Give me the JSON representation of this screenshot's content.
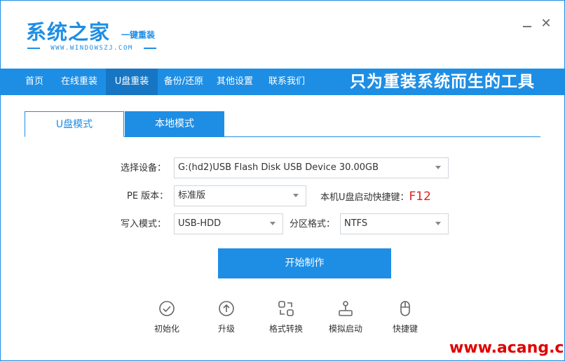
{
  "header": {
    "logo_title": "系统之家",
    "logo_subtitle": "一键重装",
    "logo_url": "WWW.WINDOWSZJ.COM",
    "minimize_label": "",
    "close_label": "✕"
  },
  "nav": {
    "items": [
      {
        "label": "首页"
      },
      {
        "label": "在线重装"
      },
      {
        "label": "U盘重装",
        "active": true
      },
      {
        "label": "备份/还原"
      },
      {
        "label": "其他设置"
      },
      {
        "label": "联系我们"
      }
    ],
    "slogan": "只为重装系统而生的工具"
  },
  "tabs": [
    {
      "label": "U盘模式",
      "active": true
    },
    {
      "label": "本地模式"
    }
  ],
  "form": {
    "device_label": "选择设备：",
    "device_value": "G:(hd2)USB Flash Disk USB Device 30.00GB",
    "pe_label": "PE 版本：",
    "pe_value": "标准版",
    "hotkey_label": "本机U盘启动快捷键：",
    "hotkey_value": "F12",
    "write_label": "写入模式：",
    "write_value": "USB-HDD",
    "partition_label": "分区格式：",
    "partition_value": "NTFS"
  },
  "start_button": "开始制作",
  "tools": [
    {
      "label": "初始化",
      "icon": "check-circle-icon"
    },
    {
      "label": "升级",
      "icon": "upgrade-arrow-icon"
    },
    {
      "label": "格式转换",
      "icon": "format-convert-icon"
    },
    {
      "label": "模拟启动",
      "icon": "joystick-icon"
    },
    {
      "label": "快捷键",
      "icon": "mouse-icon"
    }
  ],
  "watermark": "www.acang.cn",
  "colors": {
    "accent": "#1e8ee5",
    "nav_active": "#1776c4",
    "hotkey": "#e02020",
    "watermark": "#e00000"
  }
}
